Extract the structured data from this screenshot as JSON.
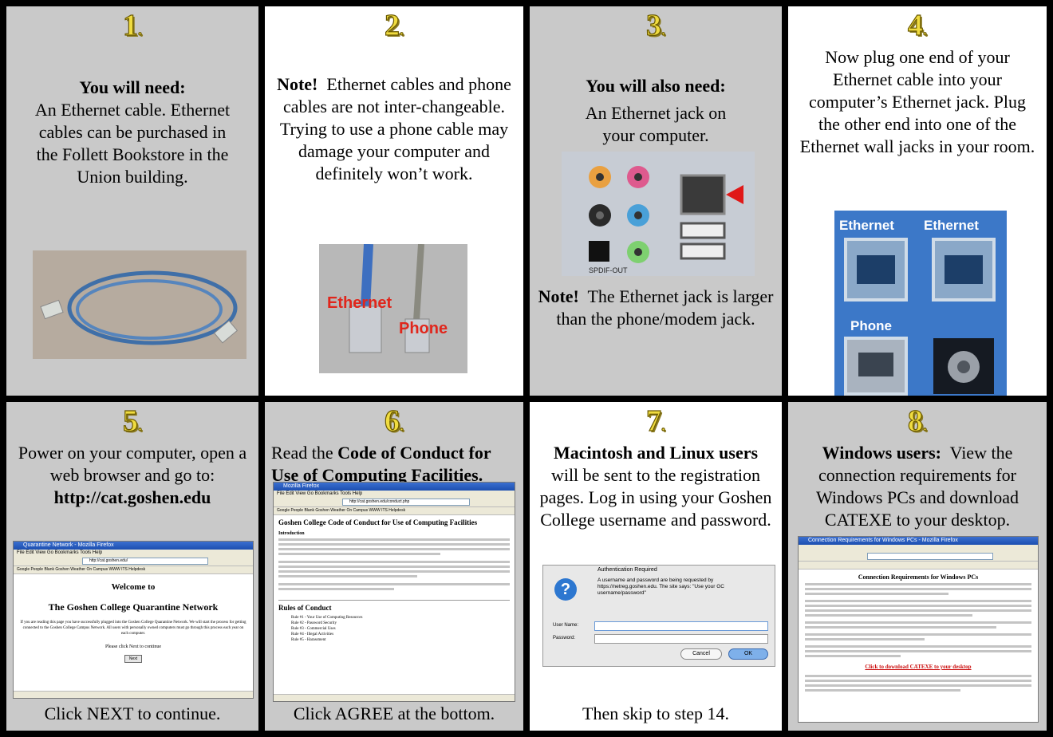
{
  "steps": [
    {
      "number": "1",
      "heading": "You will need:",
      "body": "An Ethernet cable. Ethernet cables can be purchased in the Follett Bookstore in the Union building."
    },
    {
      "number": "2",
      "note": "Note!",
      "body": "Ethernet cables and phone cables are not inter-changeable.  Trying to use a phone cable may damage your computer and definitely won’t work.",
      "photo_label_1": "Ethernet",
      "photo_label_2": "Phone"
    },
    {
      "number": "3",
      "heading": "You will also need:",
      "body": "An Ethernet jack on your computer.",
      "note": "Note!",
      "note_body": "The Ethernet jack is larger than the phone/modem jack.",
      "photo_label": "SPDIF-OUT"
    },
    {
      "number": "4",
      "body": "Now plug one end of your Ethernet cable into your computer’s Ethernet jack. Plug the other end into one of the Ethernet wall jacks in your room.",
      "photo_label_1": "Ethernet",
      "photo_label_2": "Ethernet",
      "photo_label_3": "Phone"
    },
    {
      "number": "5",
      "body": "Power on your computer, open a web browser and go to:",
      "url": "http://cat.goshen.edu",
      "footer": "Click NEXT to continue.",
      "screenshot": {
        "title": "Quarantine Network - Mozilla Firefox",
        "menu": "File  Edit  View  Go  Bookmarks  Tools  Help",
        "address": "http://cat.goshen.edu/",
        "bookmarks": "Google  People  Blank  Goshen Weather  On Campus WWW  ITS Helpdesk",
        "welcome": "Welcome to",
        "heading": "The Goshen College Quarantine Network",
        "para": "If you are reading this page you have successfully plugged into the Goshen College Quarantine Network. We will start the process for getting connected to the Goshen College Campus Network. All users with personally owned computers must go through this process each year on each computer.",
        "prompt": "Please click Next to continue",
        "button": "Next"
      }
    },
    {
      "number": "6",
      "intro": "Read the",
      "link": "Code of Conduct for Use of Computing Facilities.",
      "footer": "Click AGREE at the bottom.",
      "screenshot": {
        "title": "Mozilla Firefox",
        "menu": "File  Edit  View  Go  Bookmarks  Tools  Help",
        "address": "http://cat.goshen.edu/conduct.php",
        "bookmarks": "Google  People  Blank  Goshen Weather  On Campus WWW  ITS Helpdesk",
        "heading": "Goshen College Code of Conduct for Use of Computing Facilities",
        "sub1": "Introduction",
        "sub2": "Rules of Conduct",
        "rules": [
          "Rule #1 - Your Use of Computing Resources",
          "Rule #2 - Password Security",
          "Rule #3 - Commercial Uses",
          "Rule #4 - Illegal Activities",
          "Rule #5 - Harassment"
        ]
      }
    },
    {
      "number": "7",
      "heading": "Macintosh and Linux users",
      "body": "will be sent to the registration pages.  Log in using your Goshen College username and password.",
      "footer": "Then skip to step 14.",
      "dialog": {
        "title": "Authentication Required",
        "message": "A username and password are being requested by https://netreg.goshen.edu. The site says: \"Use your GC username/password\"",
        "user_label": "User Name:",
        "pass_label": "Password:",
        "cancel": "Cancel",
        "ok": "OK"
      }
    },
    {
      "number": "8",
      "heading": "Windows users:",
      "body": "View the connection requirements for Windows PCs and download CATEXE to your desktop.",
      "screenshot": {
        "title": "Connection Requirements for Windows PCs - Mozilla Firefox",
        "heading": "Connection Requirements for Windows PCs",
        "download": "Click to download CATEXE to your desktop"
      }
    }
  ]
}
